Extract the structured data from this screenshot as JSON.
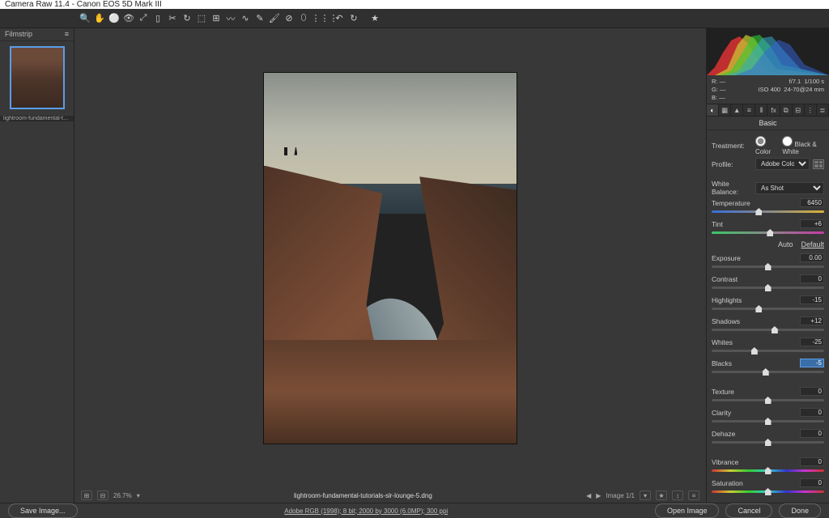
{
  "titlebar": "Camera Raw 11.4  -  Canon EOS 5D Mark III",
  "filmstrip": {
    "header": "Filmstrip",
    "menu_glyph": "≡",
    "thumb_caption": "lightroom-fundamental-tutor…"
  },
  "tools": [
    "🔍",
    "✋",
    "⚪",
    "👁",
    "⤢",
    "▯",
    "✂",
    "↻",
    "⬚",
    "⊞",
    "〰",
    "∿",
    "✎",
    "🖌",
    "⊘",
    "⬯",
    "---",
    "⋮⋮⋮",
    "↶",
    "↻",
    "---",
    "★"
  ],
  "preview": {
    "filename": "lightroom-fundamental-tutorials-slr-lounge-5.dng",
    "zoom": "26.7%",
    "page_info": "Image 1/1"
  },
  "exif": {
    "r": "R:  —",
    "g": "G:  —",
    "b": "B:  —",
    "aperture": "f/7.1",
    "shutter": "1/100 s",
    "iso": "ISO 400",
    "lens": "24-70@24 mm"
  },
  "panel_tabs": [
    "◐",
    "▦",
    "▲",
    "≡",
    "⫴",
    "fx",
    "⧉",
    "⊟",
    "⋮",
    "≣"
  ],
  "panel_title": "Basic",
  "treatment": {
    "label": "Treatment:",
    "color": "Color",
    "bw": "Black & White",
    "selected": "color"
  },
  "profile": {
    "label": "Profile:",
    "value": "Adobe Color"
  },
  "white_balance": {
    "label": "White Balance:",
    "value": "As Shot"
  },
  "links": {
    "auto": "Auto",
    "default": "Default"
  },
  "sliders": {
    "temperature": {
      "name": "Temperature",
      "value": "6450",
      "pos": 42,
      "grad": "gradient-temp"
    },
    "tint": {
      "name": "Tint",
      "value": "+6",
      "pos": 52,
      "grad": "gradient-tint"
    },
    "exposure": {
      "name": "Exposure",
      "value": "0.00",
      "pos": 50
    },
    "contrast": {
      "name": "Contrast",
      "value": "0",
      "pos": 50
    },
    "highlights": {
      "name": "Highlights",
      "value": "-15",
      "pos": 42
    },
    "shadows": {
      "name": "Shadows",
      "value": "+12",
      "pos": 56
    },
    "whites": {
      "name": "Whites",
      "value": "-25",
      "pos": 38
    },
    "blacks": {
      "name": "Blacks",
      "value": "-5",
      "pos": 48,
      "active": true
    },
    "texture": {
      "name": "Texture",
      "value": "0",
      "pos": 50
    },
    "clarity": {
      "name": "Clarity",
      "value": "0",
      "pos": 50
    },
    "dehaze": {
      "name": "Dehaze",
      "value": "0",
      "pos": 50
    },
    "vibrance": {
      "name": "Vibrance",
      "value": "0",
      "pos": 50,
      "grad": "rainbow"
    },
    "saturation": {
      "name": "Saturation",
      "value": "0",
      "pos": 50,
      "grad": "rainbow"
    }
  },
  "footer": {
    "save_image": "Save Image...",
    "meta": "Adobe RGB (1998); 8 bit; 2000 by 3000 (6.0MP); 300 ppi",
    "open_image": "Open Image",
    "cancel": "Cancel",
    "done": "Done"
  }
}
